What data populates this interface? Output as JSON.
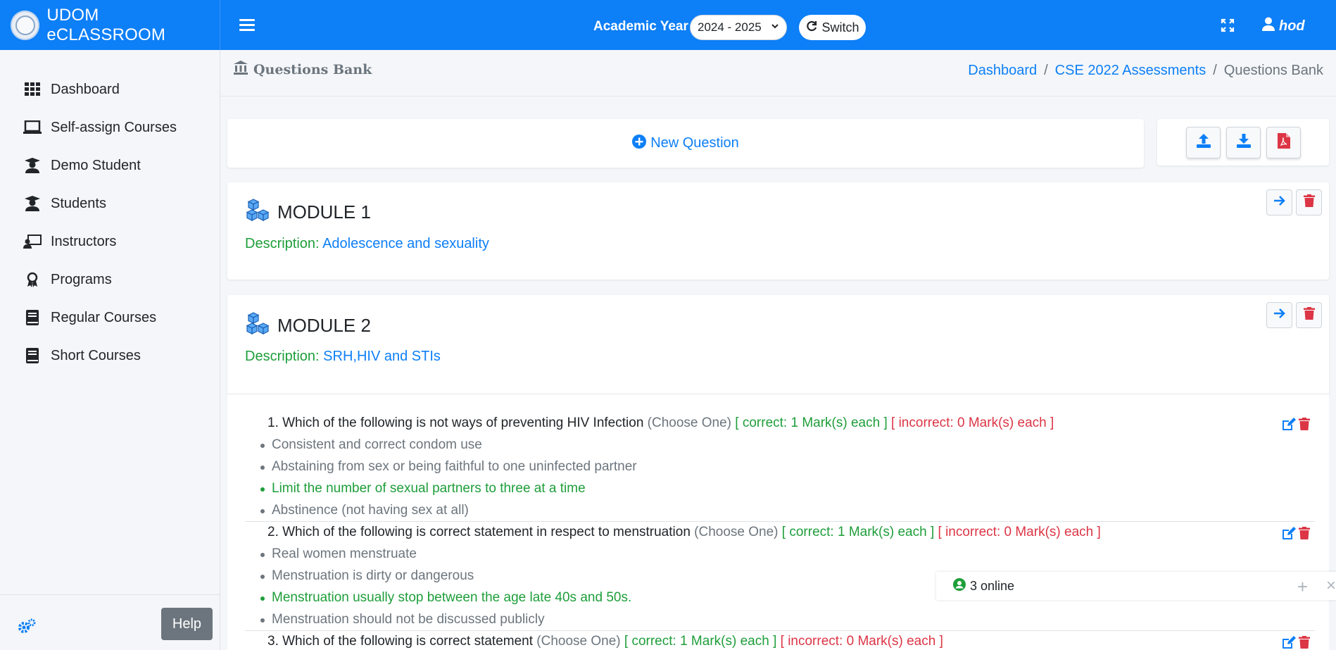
{
  "brand": {
    "name": "UDOM eCLASSROOM"
  },
  "topbar": {
    "academic_year_label": "Academic Year",
    "academic_year_value": "2024 - 2025",
    "switch_label": "Switch",
    "user_name": "hod",
    "accent_color": "#0d7ff7"
  },
  "sidebar": {
    "items": [
      {
        "label": "Dashboard",
        "icon": "grid-icon"
      },
      {
        "label": "Self-assign Courses",
        "icon": "laptop-icon"
      },
      {
        "label": "Demo Student",
        "icon": "graduate-icon"
      },
      {
        "label": "Students",
        "icon": "graduate-icon"
      },
      {
        "label": "Instructors",
        "icon": "teacher-icon"
      },
      {
        "label": "Programs",
        "icon": "award-icon"
      },
      {
        "label": "Regular Courses",
        "icon": "book-icon"
      },
      {
        "label": "Short Courses",
        "icon": "book-icon"
      }
    ],
    "help_label": "Help"
  },
  "header": {
    "title": "Questions Bank",
    "breadcrumb": [
      "Dashboard",
      "CSE 2022 Assessments",
      "Questions Bank"
    ]
  },
  "toolbar": {
    "new_question_label": "New Question"
  },
  "modules": [
    {
      "title": "MODULE 1",
      "description_label": "Description:",
      "description": "Adolescence and sexuality"
    },
    {
      "title": "MODULE 2",
      "description_label": "Description:",
      "description": "SRH,HIV and STIs"
    }
  ],
  "questions": [
    {
      "text": "1. Which of the following is not ways of preventing HIV Infection",
      "type": "(Choose One)",
      "correct": "[ correct: 1 Mark(s) each ]",
      "incorrect": "[ incorrect: 0 Mark(s) each ]",
      "options": [
        {
          "text": "Consistent and correct condom use",
          "correct": false
        },
        {
          "text": "Abstaining from sex or being faithful to one uninfected partner",
          "correct": false
        },
        {
          "text": "Limit the number of sexual partners to three at a time",
          "correct": true
        },
        {
          "text": "Abstinence (not having sex at all)",
          "correct": false
        }
      ]
    },
    {
      "text": "2. Which of the following is correct statement in respect to menstruation",
      "type": "(Choose One)",
      "correct": "[ correct: 1 Mark(s) each ]",
      "incorrect": "[ incorrect: 0 Mark(s) each ]",
      "options": [
        {
          "text": "Real women menstruate",
          "correct": false
        },
        {
          "text": "Menstruation is dirty or dangerous",
          "correct": false
        },
        {
          "text": "Menstruation usually stop between the age late 40s and 50s.",
          "correct": true
        },
        {
          "text": "Menstruation should not be discussed publicly",
          "correct": false
        }
      ]
    },
    {
      "text": "3. Which of the following is correct statement",
      "type": "(Choose One)",
      "correct": "[ correct: 1 Mark(s) each ]",
      "incorrect": "[ incorrect: 0 Mark(s) each ]",
      "options": []
    }
  ],
  "online_widget": {
    "label": "3 online",
    "plus": "+",
    "close": "×"
  }
}
